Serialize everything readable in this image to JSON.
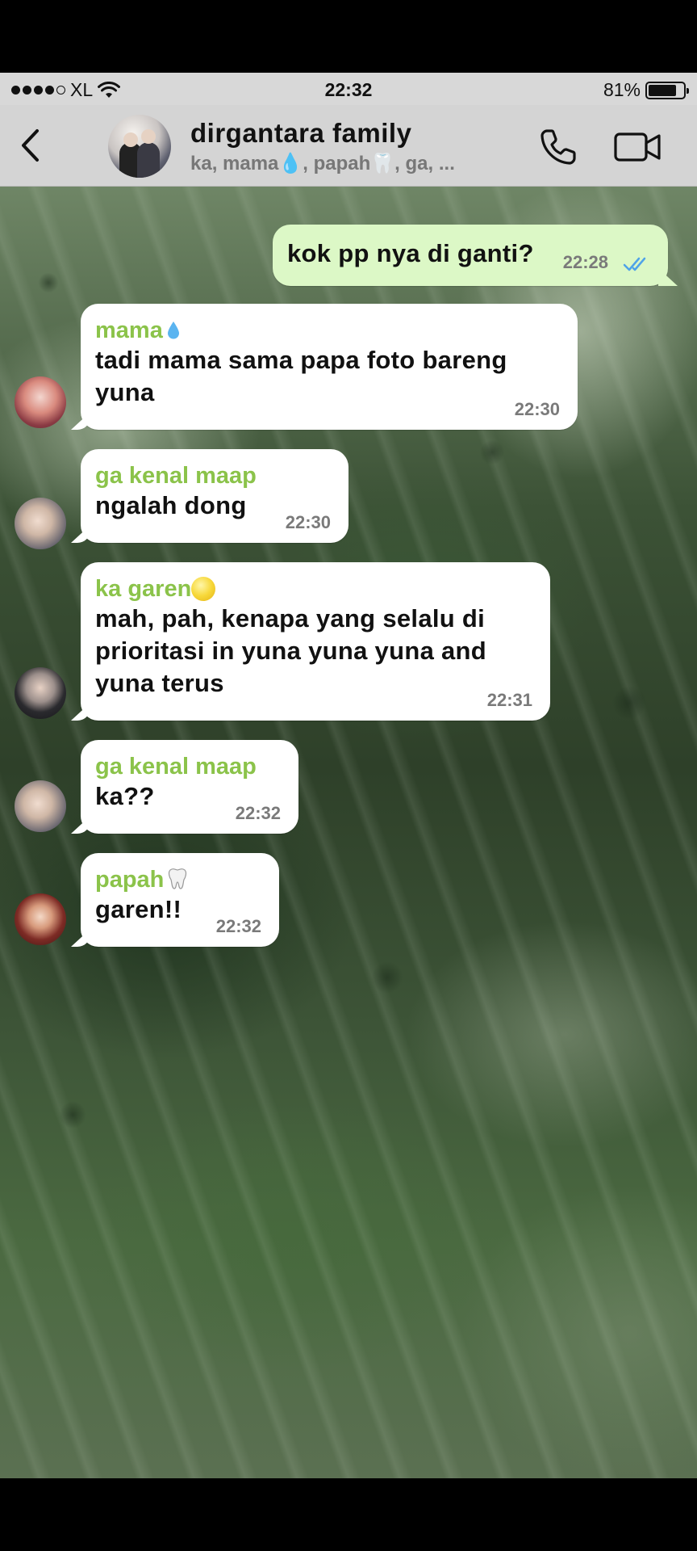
{
  "status_bar": {
    "carrier": "XL",
    "time": "22:32",
    "battery_text": "81%",
    "battery_level": 0.81
  },
  "header": {
    "title": "dirgantara family",
    "subtitle": "ka, mama💧, papah🦷, ga, ...",
    "icons": [
      "back-chevron-icon",
      "phone-icon",
      "video-camera-icon"
    ]
  },
  "messages": [
    {
      "direction": "out",
      "text": "kok pp nya di ganti?",
      "time": "22:28",
      "status": "read"
    },
    {
      "direction": "in",
      "sender": "mama",
      "sender_emoji": "droplet",
      "text_lines": [
        "tadi mama sama papa foto bareng",
        "yuna"
      ],
      "time": "22:30"
    },
    {
      "direction": "in",
      "sender": "ga kenal maap",
      "text": "ngalah dong",
      "time": "22:30"
    },
    {
      "direction": "in",
      "sender": "ka garen",
      "sender_emoji": "yellow-circle",
      "text_lines": [
        "mah, pah, kenapa yang selalu di",
        "prioritasi in yuna yuna yuna and",
        "yuna terus"
      ],
      "time": "22:31"
    },
    {
      "direction": "in",
      "sender": "ga kenal maap",
      "text": "ka??",
      "time": "22:32"
    },
    {
      "direction": "in",
      "sender": "papah",
      "sender_emoji": "tooth",
      "text": "garen!!",
      "time": "22:32"
    }
  ],
  "colors": {
    "sender_name": "#8bc34a",
    "outgoing_bubble": "#dcf8c6",
    "incoming_bubble": "#ffffff",
    "read_ticks": "#4fa3e8"
  }
}
